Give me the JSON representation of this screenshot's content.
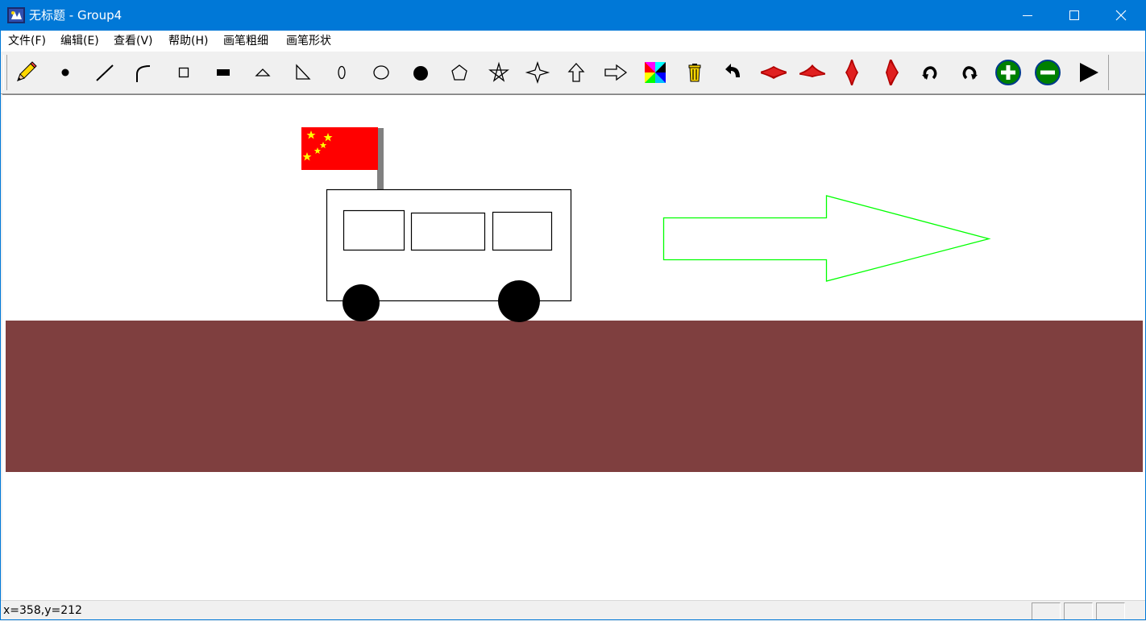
{
  "window": {
    "title": "无标题 - Group4",
    "accent_color": "#0078d7",
    "controls": [
      "minimize-icon",
      "maximize-icon",
      "close-icon"
    ]
  },
  "menu": {
    "items": [
      "文件(F)",
      "编辑(E)",
      "查看(V)",
      "帮助(H)",
      "画笔粗细",
      "画笔形状"
    ]
  },
  "toolbar": {
    "tools": [
      {
        "icon": "pencil-icon"
      },
      {
        "icon": "dot-icon"
      },
      {
        "icon": "line-icon"
      },
      {
        "icon": "arc-icon"
      },
      {
        "icon": "rectangle-icon"
      },
      {
        "icon": "filled-rectangle-icon"
      },
      {
        "icon": "triangle-icon"
      },
      {
        "icon": "right-triangle-icon"
      },
      {
        "icon": "small-ellipse-icon"
      },
      {
        "icon": "ellipse-icon"
      },
      {
        "icon": "filled-circle-icon"
      },
      {
        "icon": "pentagon-icon"
      },
      {
        "icon": "pentagram-icon"
      },
      {
        "icon": "four-point-star-icon"
      },
      {
        "icon": "up-arrow-icon"
      },
      {
        "icon": "right-arrow-icon"
      },
      {
        "icon": "color-palette-icon"
      },
      {
        "icon": "trash-icon"
      },
      {
        "icon": "undo-icon"
      },
      {
        "icon": "flatten-vertical-icon"
      },
      {
        "icon": "flatten-vertical-alt-icon"
      },
      {
        "icon": "flatten-horizontal-icon"
      },
      {
        "icon": "flatten-horizontal-alt-icon"
      },
      {
        "icon": "rotate-left-icon"
      },
      {
        "icon": "rotate-right-icon"
      },
      {
        "icon": "zoom-in-icon"
      },
      {
        "icon": "zoom-out-icon"
      },
      {
        "icon": "play-icon"
      }
    ]
  },
  "canvas": {
    "background": "#ffffff",
    "ground_color": "#7f3f3f",
    "arrow_color": "#00ff00",
    "flag_color": "#ff0000",
    "star_color": "#ffff00",
    "pole_color": "#808080",
    "outline_color": "#000000"
  },
  "status": {
    "coordinates": "x=358,y=212"
  }
}
